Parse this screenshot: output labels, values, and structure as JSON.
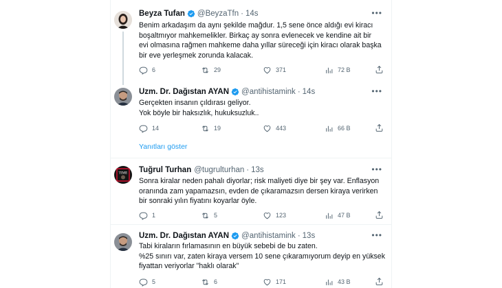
{
  "colors": {
    "accent": "#1d9bf0",
    "muted": "#536471",
    "text": "#0f1419",
    "verified": "#1d9bf0",
    "border": "#eff3f4"
  },
  "tweets": [
    {
      "name": "Beyza Tufan",
      "verified": true,
      "handle": "@BeyzaTfn",
      "time": "14s",
      "lines": [
        "Benim arkadaşım da aynı şekilde mağdur. 1,5 sene önce aldığı evi kiracı",
        "boşaltmıyor mahkemelikler. Birkaç ay sonra evlenecek ve kendine ait bir",
        "evi olmasına rağmen mahkeme daha yıllar süreceği için kiracı olarak başka",
        "bir eve yerleşmek zorunda kalacak."
      ],
      "replies": "6",
      "retweets": "29",
      "likes": "371",
      "views": "72 B"
    },
    {
      "name": "Uzm. Dr. Dağıstan AYAN",
      "verified": true,
      "handle": "@antihistamink",
      "time": "14s",
      "lines": [
        "Gerçekten insanın çıldırası geliyor.",
        "Yok böyle bir haksızlık, hukuksuzluk.."
      ],
      "replies": "14",
      "retweets": "19",
      "likes": "443",
      "views": "66 B"
    },
    {
      "name": "Tuğrul Turhan",
      "verified": false,
      "handle": "@tugrulturhan",
      "time": "13s",
      "lines": [
        "Sonra kiralar neden pahalı diyorlar; risk maliyeti diye bir şey var. Enflasyon",
        "oranında zam yapamazsın, evden de çıkaramazsın dersen kiraya verirken",
        "bir sonraki yılın fiyatını koyarlar öyle."
      ],
      "replies": "1",
      "retweets": "5",
      "likes": "123",
      "views": "47 B"
    },
    {
      "name": "Uzm. Dr. Dağıstan AYAN",
      "verified": true,
      "handle": "@antihistamink",
      "time": "13s",
      "lines": [
        "Tabi kiraların fırlamasının en büyük sebebi de bu zaten.",
        "%25 sınırı var, zaten kiraya versem 10 sene çıkaramıyorum deyip en yüksek",
        "fiyattan veriyorlar \"haklı olarak\""
      ],
      "replies": "5",
      "retweets": "6",
      "likes": "171",
      "views": "43 B"
    }
  ],
  "show_replies": "Yanıtları göster",
  "avatar_badge": "TIME"
}
